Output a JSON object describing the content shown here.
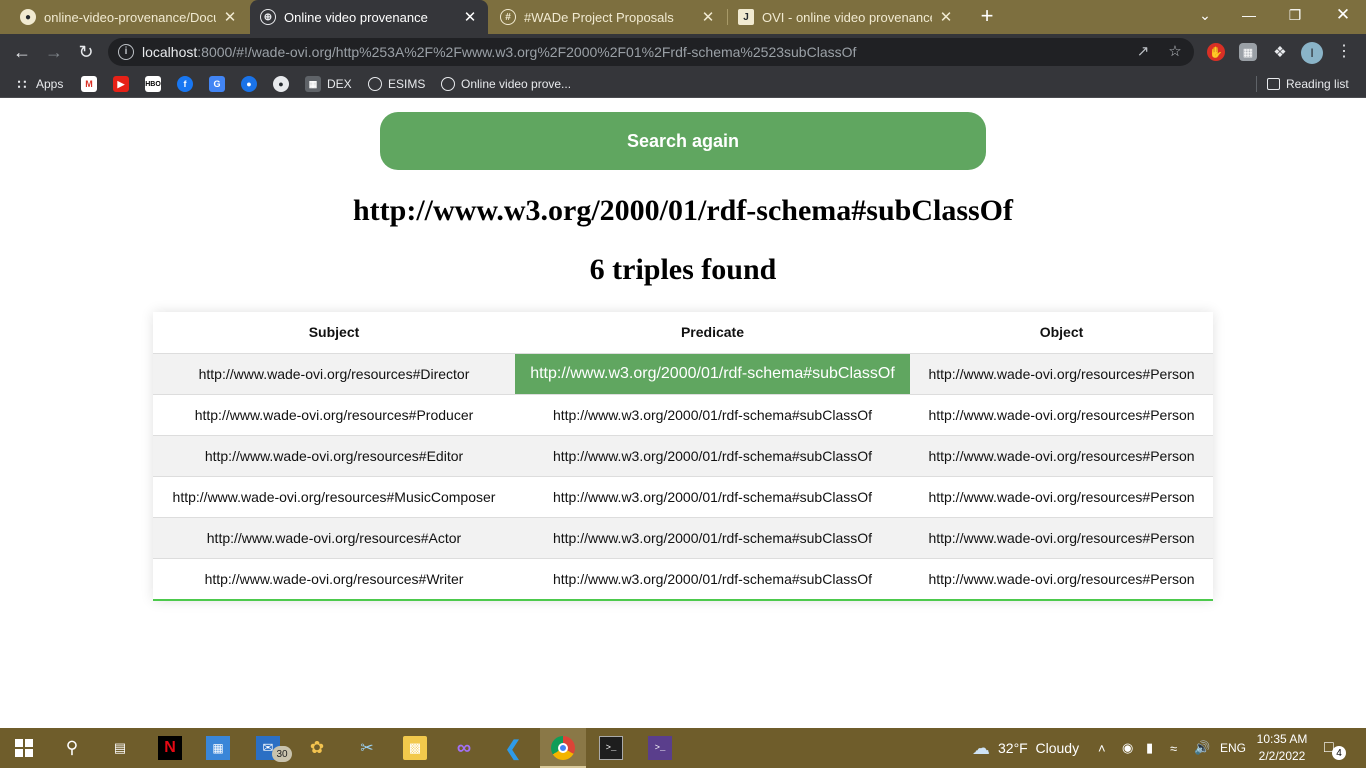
{
  "browser": {
    "tabs": [
      {
        "title": "online-video-provenance/Docum",
        "icon": "github-icon"
      },
      {
        "title": "Online video provenance",
        "icon": "globe-icon"
      },
      {
        "title": "#WADe Project Proposals",
        "icon": "slack-icon"
      },
      {
        "title": "OVI - online video provenance -",
        "icon": "jira-icon"
      }
    ],
    "url_host": "localhost",
    "url_rest": ":8000/#!/wade-ovi.org/http%253A%2F%2Fwww.w3.org%2F2000%2F01%2Frdf-schema%2523subClassOf",
    "profile_initial": "I",
    "bookmarks": [
      {
        "label": "Apps",
        "icon": "apps-grid-icon"
      },
      {
        "label": "",
        "icon": "gmail-icon"
      },
      {
        "label": "",
        "icon": "youtube-icon"
      },
      {
        "label": "",
        "icon": "hbo-icon"
      },
      {
        "label": "",
        "icon": "facebook-icon"
      },
      {
        "label": "",
        "icon": "google-translate-icon"
      },
      {
        "label": "",
        "icon": "bookmark-blue-icon"
      },
      {
        "label": "",
        "icon": "github-icon"
      },
      {
        "label": "DEX",
        "icon": "dex-icon"
      },
      {
        "label": "ESIMS",
        "icon": "globe-icon"
      },
      {
        "label": "Online video prove...",
        "icon": "globe-icon"
      }
    ],
    "reading_list": "Reading list"
  },
  "page": {
    "search_again": "Search again",
    "resource_uri": "http://www.w3.org/2000/01/rdf-schema#subClassOf",
    "triples_found": "6 triples found",
    "table": {
      "headers": [
        "Subject",
        "Predicate",
        "Object"
      ],
      "rows": [
        {
          "subject": "http://www.wade-ovi.org/resources#Director",
          "predicate": "http://www.w3.org/2000/01/rdf-schema#subClassOf",
          "object": "http://www.wade-ovi.org/resources#Person"
        },
        {
          "subject": "http://www.wade-ovi.org/resources#Producer",
          "predicate": "http://www.w3.org/2000/01/rdf-schema#subClassOf",
          "object": "http://www.wade-ovi.org/resources#Person"
        },
        {
          "subject": "http://www.wade-ovi.org/resources#Editor",
          "predicate": "http://www.w3.org/2000/01/rdf-schema#subClassOf",
          "object": "http://www.wade-ovi.org/resources#Person"
        },
        {
          "subject": "http://www.wade-ovi.org/resources#MusicComposer",
          "predicate": "http://www.w3.org/2000/01/rdf-schema#subClassOf",
          "object": "http://www.wade-ovi.org/resources#Person"
        },
        {
          "subject": "http://www.wade-ovi.org/resources#Actor",
          "predicate": "http://www.w3.org/2000/01/rdf-schema#subClassOf",
          "object": "http://www.wade-ovi.org/resources#Person"
        },
        {
          "subject": "http://www.wade-ovi.org/resources#Writer",
          "predicate": "http://www.w3.org/2000/01/rdf-schema#subClassOf",
          "object": "http://www.wade-ovi.org/resources#Person"
        }
      ]
    },
    "colors": {
      "accent_green": "#60a660",
      "table_border_green": "#4cc94c"
    }
  },
  "taskbar": {
    "mail_badge": "30",
    "weather": "32°F  Cloudy",
    "language": "ENG",
    "time": "10:35 AM",
    "date": "2/2/2022",
    "notification_count": "4"
  }
}
